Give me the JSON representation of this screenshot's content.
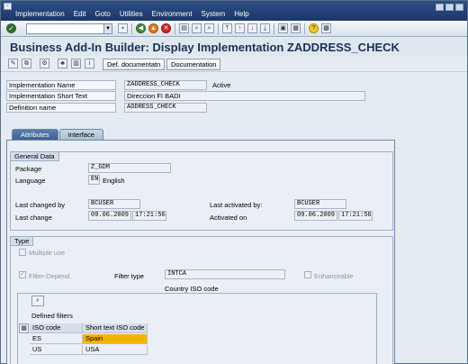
{
  "menu": [
    "Implementation",
    "Edit",
    "Goto",
    "Utilities",
    "Environment",
    "System",
    "Help"
  ],
  "icons": {
    "logo": "sap-logo-icon",
    "enter": "enter-check-icon"
  },
  "title": "Business Add-In Builder: Display Implementation ZADDRESS_CHECK",
  "app_toolbar": {
    "def_doc": "Def. documentatn",
    "documentation": "Documentation"
  },
  "header": {
    "impl_name_label": "Implementation Name",
    "impl_name_value": "ZADDRESS_CHECK",
    "impl_status": "Active",
    "short_text_label": "Implementation Short Text",
    "short_text_value": "Direccion FI BADI",
    "def_name_label": "Definition name",
    "def_name_value": "ADDRESS_CHECK"
  },
  "tabs": [
    "Attributes",
    "Interface"
  ],
  "general": {
    "title": "General Data",
    "package_label": "Package",
    "package_value": "Z_GDM",
    "language_label": "Language",
    "language_code": "EN",
    "language_name": "English",
    "last_changed_by_label": "Last changed by",
    "last_changed_by_value": "BCUSER",
    "last_change_label": "Last change",
    "last_change_date": "09.06.2009",
    "last_change_time": "17:21:56",
    "last_activated_by_label": "Last activated by:",
    "last_activated_by_value": "BCUSER",
    "activated_on_label": "Activated on",
    "activated_on_date": "09.06.2009",
    "activated_on_time": "17:21:56"
  },
  "type": {
    "title": "Type",
    "multiple_use": "Multiple use",
    "filter_depend": "Filter-Depend.",
    "filter_type_label": "Filter type",
    "filter_type_value": "INTCA",
    "enhanceable": "Enhanceable",
    "filter_type_desc": "Country ISO code",
    "defined_filters": "Defined filters"
  },
  "table": {
    "columns": [
      "ISO code",
      "Short text ISO code"
    ],
    "rows": [
      {
        "iso": "ES",
        "text": "Spain"
      },
      {
        "iso": "US",
        "text": "USA"
      }
    ]
  },
  "colors": {
    "menubar": "#1b3768",
    "title": "#1c3157",
    "selected_cell": "#f5b400"
  }
}
